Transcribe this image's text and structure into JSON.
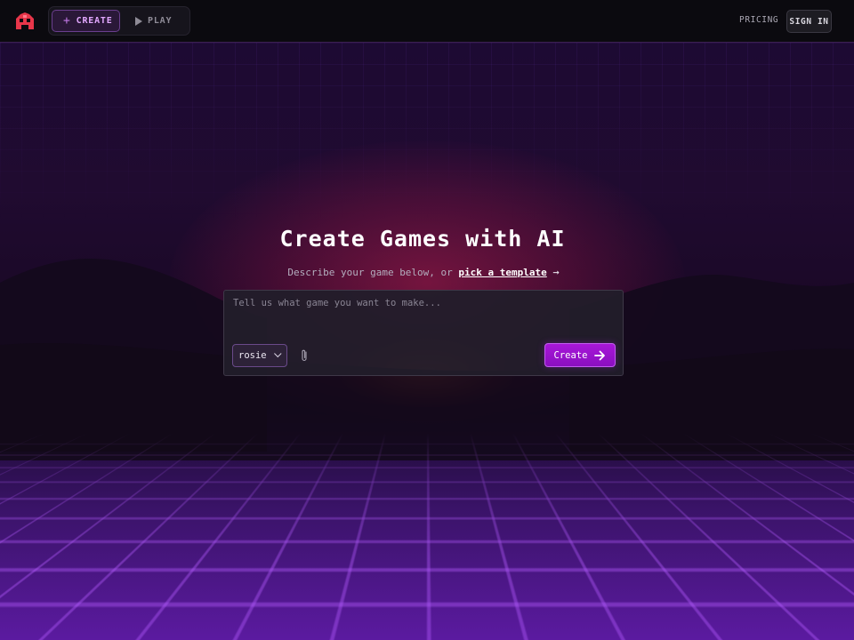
{
  "header": {
    "modes": [
      {
        "label": "CREATE",
        "icon": "plus-icon",
        "active": true
      },
      {
        "label": "PLAY",
        "icon": "play-icon",
        "active": false
      }
    ],
    "pricing_label": "PRICING",
    "signin_label": "SIGN IN"
  },
  "hero": {
    "title": "Create Games with AI",
    "subtitle_prefix": "Describe your game below, or ",
    "template_link": "pick a template",
    "template_arrow": "→"
  },
  "prompt": {
    "placeholder": "Tell us what game you want to make...",
    "value": "",
    "model_selected": "rosie",
    "create_label": "Create"
  },
  "colors": {
    "accent": "#a817d8",
    "brand_logo": "#e8364a",
    "header_bg": "#0b0a0f"
  }
}
